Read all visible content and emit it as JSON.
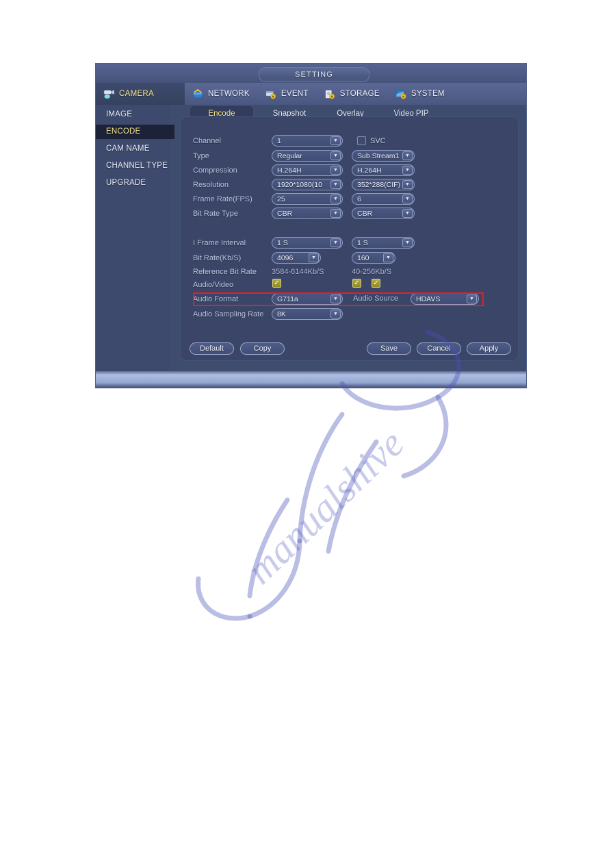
{
  "window": {
    "title": "SETTING"
  },
  "menubar": {
    "items": [
      {
        "label": "CAMERA",
        "icon": "camera-icon",
        "active": true
      },
      {
        "label": "NETWORK",
        "icon": "network-icon",
        "active": false
      },
      {
        "label": "EVENT",
        "icon": "event-icon",
        "active": false
      },
      {
        "label": "STORAGE",
        "icon": "storage-icon",
        "active": false
      },
      {
        "label": "SYSTEM",
        "icon": "system-icon",
        "active": false
      }
    ]
  },
  "sidebar": {
    "items": [
      {
        "label": "IMAGE",
        "active": false
      },
      {
        "label": "ENCODE",
        "active": true
      },
      {
        "label": "CAM NAME",
        "active": false
      },
      {
        "label": "CHANNEL TYPE",
        "active": false
      },
      {
        "label": "UPGRADE",
        "active": false
      }
    ]
  },
  "tabs": [
    {
      "label": "Encode",
      "active": true
    },
    {
      "label": "Snapshot",
      "active": false
    },
    {
      "label": "Overlay",
      "active": false
    },
    {
      "label": "Video PIP",
      "active": false
    }
  ],
  "form": {
    "svc": {
      "label": "SVC",
      "checked": false
    },
    "rows": [
      {
        "label": "Channel",
        "main": "1",
        "sub": null
      },
      {
        "label": "Type",
        "main": "Regular",
        "sub": "Sub Stream1"
      },
      {
        "label": "Compression",
        "main": "H.264H",
        "sub": "H.264H"
      },
      {
        "label": "Resolution",
        "main": "1920*1080(10",
        "sub": "352*288(CIF)"
      },
      {
        "label": "Frame Rate(FPS)",
        "main": "25",
        "sub": "6"
      },
      {
        "label": "Bit Rate Type",
        "main": "CBR",
        "sub": "CBR"
      },
      {
        "label": "I Frame Interval",
        "main": "1 S",
        "sub": "1 S"
      },
      {
        "label": "Bit Rate(Kb/S)",
        "main": "4096",
        "sub": "160"
      }
    ],
    "reference_bit_rate": {
      "label": "Reference Bit Rate",
      "main": "3584-6144Kb/S",
      "sub": "40-256Kb/S"
    },
    "audio_video": {
      "label": "Audio/Video",
      "main_checked": true,
      "sub_checked_1": true,
      "sub_checked_2": true
    },
    "audio_format": {
      "label": "Audio Format",
      "value": "G711a"
    },
    "audio_source": {
      "label": "Audio Source",
      "value": "HDAVS"
    },
    "audio_sampling_rate": {
      "label": "Audio Sampling Rate",
      "value": "8K"
    }
  },
  "buttons": {
    "default": "Default",
    "copy": "Copy",
    "save": "Save",
    "cancel": "Cancel",
    "apply": "Apply"
  },
  "colors": {
    "highlight": "#ed1c24",
    "accent_text": "#f6e58d",
    "panel": "#3a4568",
    "window": "#3e4c6e"
  }
}
